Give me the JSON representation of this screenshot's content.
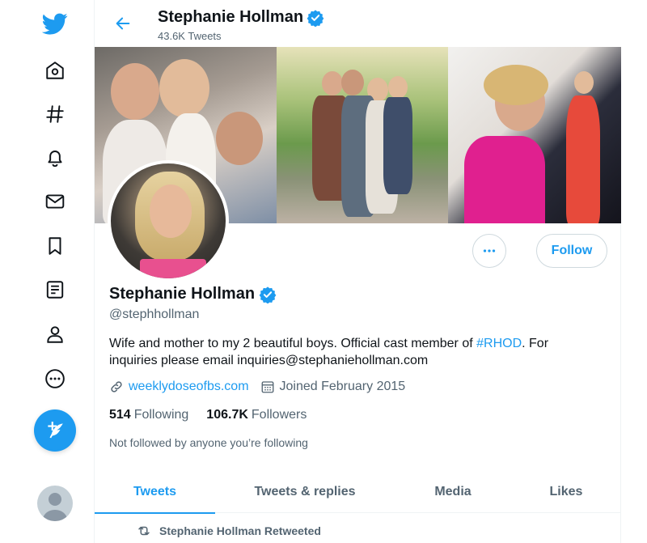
{
  "sidebar": {
    "items": [
      {
        "icon": "home-icon"
      },
      {
        "icon": "explore-hashtag-icon"
      },
      {
        "icon": "notifications-bell-icon"
      },
      {
        "icon": "messages-mail-icon"
      },
      {
        "icon": "bookmarks-icon"
      },
      {
        "icon": "lists-icon"
      },
      {
        "icon": "profile-icon"
      },
      {
        "icon": "more-circle-icon"
      }
    ]
  },
  "header": {
    "name": "Stephanie Hollman",
    "tweet_count": "43.6K Tweets"
  },
  "profile": {
    "name": "Stephanie Hollman",
    "handle": "@stephhollman",
    "bio_before": "Wife and mother to my 2 beautiful boys. Official cast member of ",
    "bio_tag": "#RHOD",
    "bio_after": ". For inquiries please email inquiries@stephaniehollman.com",
    "website": "weeklydoseofbs.com",
    "joined": "Joined February 2015",
    "following_count": "514",
    "following_label": "Following",
    "followers_count": "106.7K",
    "followers_label": "Followers",
    "not_followed_note": "Not followed by anyone you’re following",
    "follow_label": "Follow"
  },
  "tabs": [
    {
      "label": "Tweets",
      "active": true
    },
    {
      "label": "Tweets & replies",
      "active": false
    },
    {
      "label": "Media",
      "active": false
    },
    {
      "label": "Likes",
      "active": false
    }
  ],
  "timeline": {
    "retweet_label": "Stephanie Hollman Retweeted"
  },
  "colors": {
    "accent": "#1d9bf0",
    "text": "#0f1419",
    "secondary": "#536471",
    "border": "#cfd9de"
  }
}
